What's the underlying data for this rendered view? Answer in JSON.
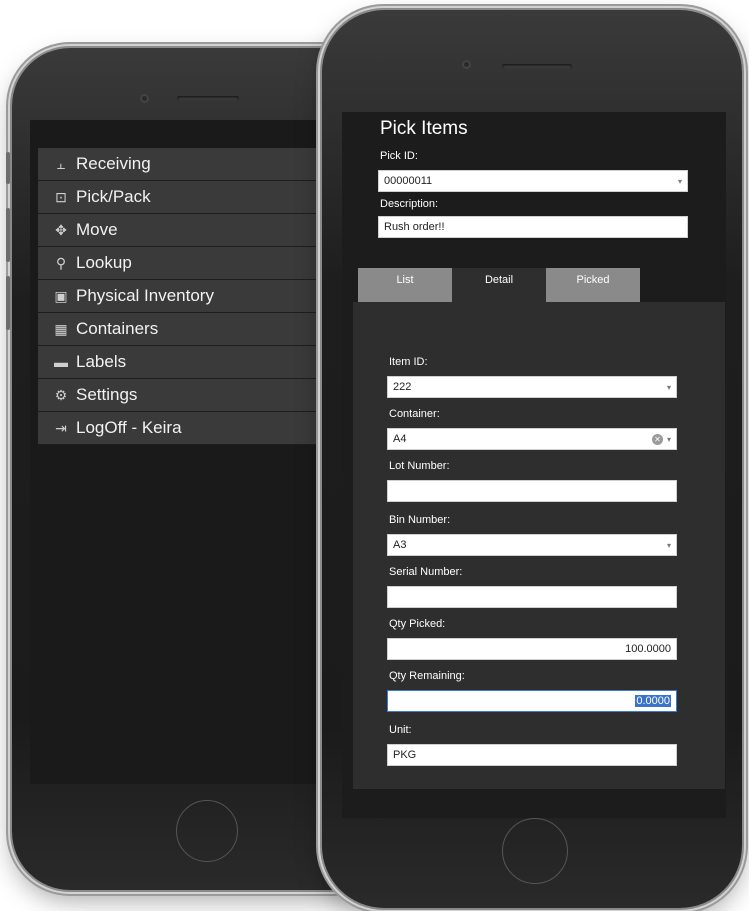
{
  "back_menu": {
    "items": [
      {
        "icon": "receiving-icon",
        "glyph": "⫠",
        "label": "Receiving"
      },
      {
        "icon": "pick-pack-icon",
        "glyph": "⊡",
        "label": "Pick/Pack"
      },
      {
        "icon": "move-icon",
        "glyph": "✥",
        "label": "Move"
      },
      {
        "icon": "lookup-icon",
        "glyph": "⚲",
        "label": "Lookup"
      },
      {
        "icon": "physical-inventory-icon",
        "glyph": "▣",
        "label": "Physical Inventory"
      },
      {
        "icon": "containers-icon",
        "glyph": "▦",
        "label": "Containers"
      },
      {
        "icon": "labels-icon",
        "glyph": "▬",
        "label": "Labels"
      },
      {
        "icon": "settings-icon",
        "glyph": "⚙",
        "label": "Settings"
      },
      {
        "icon": "logoff-icon",
        "glyph": "⇥",
        "label": "LogOff - Keira"
      }
    ]
  },
  "pick_items": {
    "title": "Pick Items",
    "pick_id_label": "Pick ID:",
    "pick_id_value": "00000011",
    "description_label": "Description:",
    "description_value": "Rush order!!",
    "tabs": [
      "List",
      "Detail",
      "Picked"
    ],
    "item_id_label": "Item ID:",
    "item_id_value": "222",
    "container_label": "Container:",
    "container_value": "A4",
    "lot_number_label": "Lot Number:",
    "lot_number_value": "",
    "bin_number_label": "Bin Number:",
    "bin_number_value": "A3",
    "serial_number_label": "Serial Number:",
    "serial_number_value": "",
    "qty_picked_label": "Qty Picked:",
    "qty_picked_value": "100.0000",
    "qty_remaining_label": "Qty Remaining:",
    "qty_remaining_value": "0.0000",
    "unit_label": "Unit:",
    "unit_value": "PKG"
  },
  "glyphs": {
    "dropdown": "▾",
    "clear": "✕"
  },
  "colors": {
    "panel": "#2e2e2e",
    "screen": "#1c1c1c",
    "accent": "#3a7bd5",
    "inactive_tab": "#8a8a8a"
  }
}
